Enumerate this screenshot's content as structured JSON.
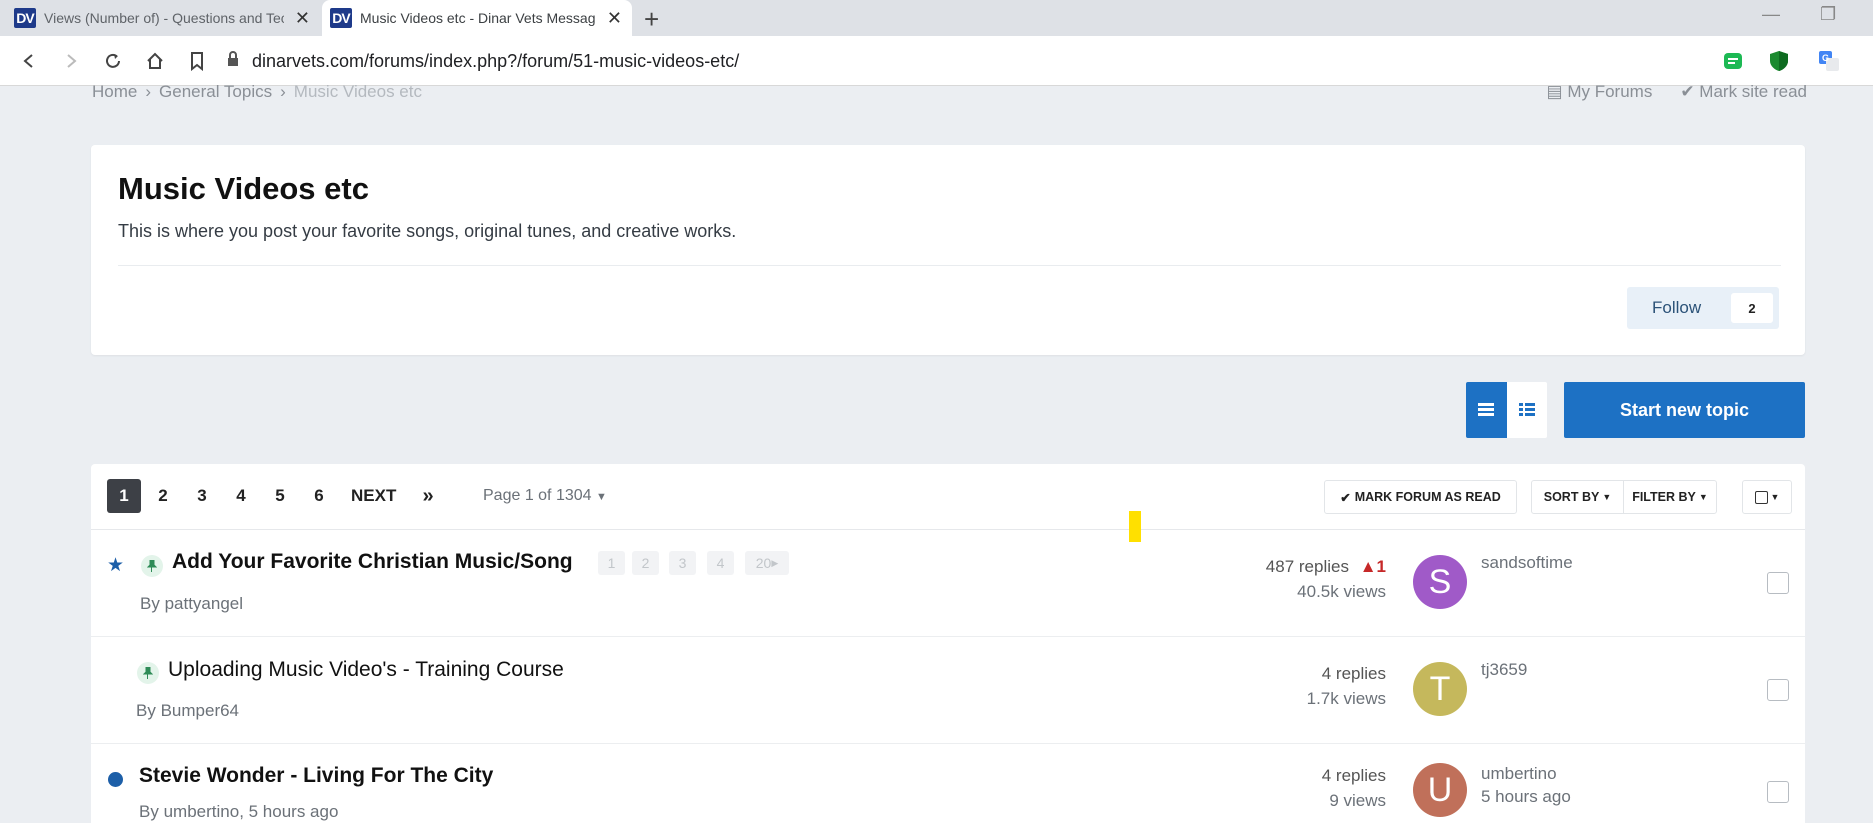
{
  "browser": {
    "tabs": [
      {
        "title": "Views (Number of) - Questions and Tech",
        "favicon": "DV"
      },
      {
        "title": "Music Videos etc - Dinar Vets Message Board",
        "favicon": "DV"
      }
    ],
    "url": "dinarvets.com/forums/index.php?/forum/51-music-videos-etc/"
  },
  "breadcrumb": {
    "home": "Home",
    "parent": "General Topics",
    "current": "Music Videos etc"
  },
  "top_links": {
    "my_forums": "My Forums",
    "mark_site_read": "Mark site read"
  },
  "forum": {
    "title": "Music Videos etc",
    "description": "This is where you post your favorite songs, original tunes, and creative works.",
    "follow_label": "Follow",
    "follow_count": "2"
  },
  "actions": {
    "start_new_topic": "Start new topic"
  },
  "pagination": {
    "pages": [
      "1",
      "2",
      "3",
      "4",
      "5",
      "6"
    ],
    "next": "NEXT",
    "last": "»",
    "page_of": "Page 1 of 1304",
    "mark_forum_read": "MARK FORUM AS READ",
    "sort_by": "SORT BY",
    "filter_by": "FILTER BY"
  },
  "topics": [
    {
      "title": "Add Your Favorite Christian Music/Song",
      "by_prefix": "By",
      "author": "pattyangel",
      "mini_pages": [
        "1",
        "2",
        "3",
        "4",
        "20"
      ],
      "replies": "487 replies",
      "reports": "1",
      "views": "40.5k views",
      "last_user": "sandsoftime",
      "avatar_letter": "S",
      "avatar_color": "#a05ac8"
    },
    {
      "title": "Uploading Music Video's - Training Course",
      "by_prefix": "By",
      "author": "Bumper64",
      "replies": "4 replies",
      "views": "1.7k views",
      "last_user": "tj3659",
      "avatar_letter": "T",
      "avatar_color": "#c5b85c"
    },
    {
      "title": "Stevie Wonder - Living For The City",
      "by_prefix": "By",
      "author": "umbertino",
      "author_time": ", 5 hours ago",
      "replies": "4 replies",
      "views": "9 views",
      "last_user": "umbertino",
      "last_time": "5 hours ago",
      "avatar_letter": "U",
      "avatar_color": "#c0705a"
    }
  ],
  "colors": {
    "accent": "#1d71c4",
    "unread_dot": "#1d5fa8",
    "warning": "#c62828"
  }
}
